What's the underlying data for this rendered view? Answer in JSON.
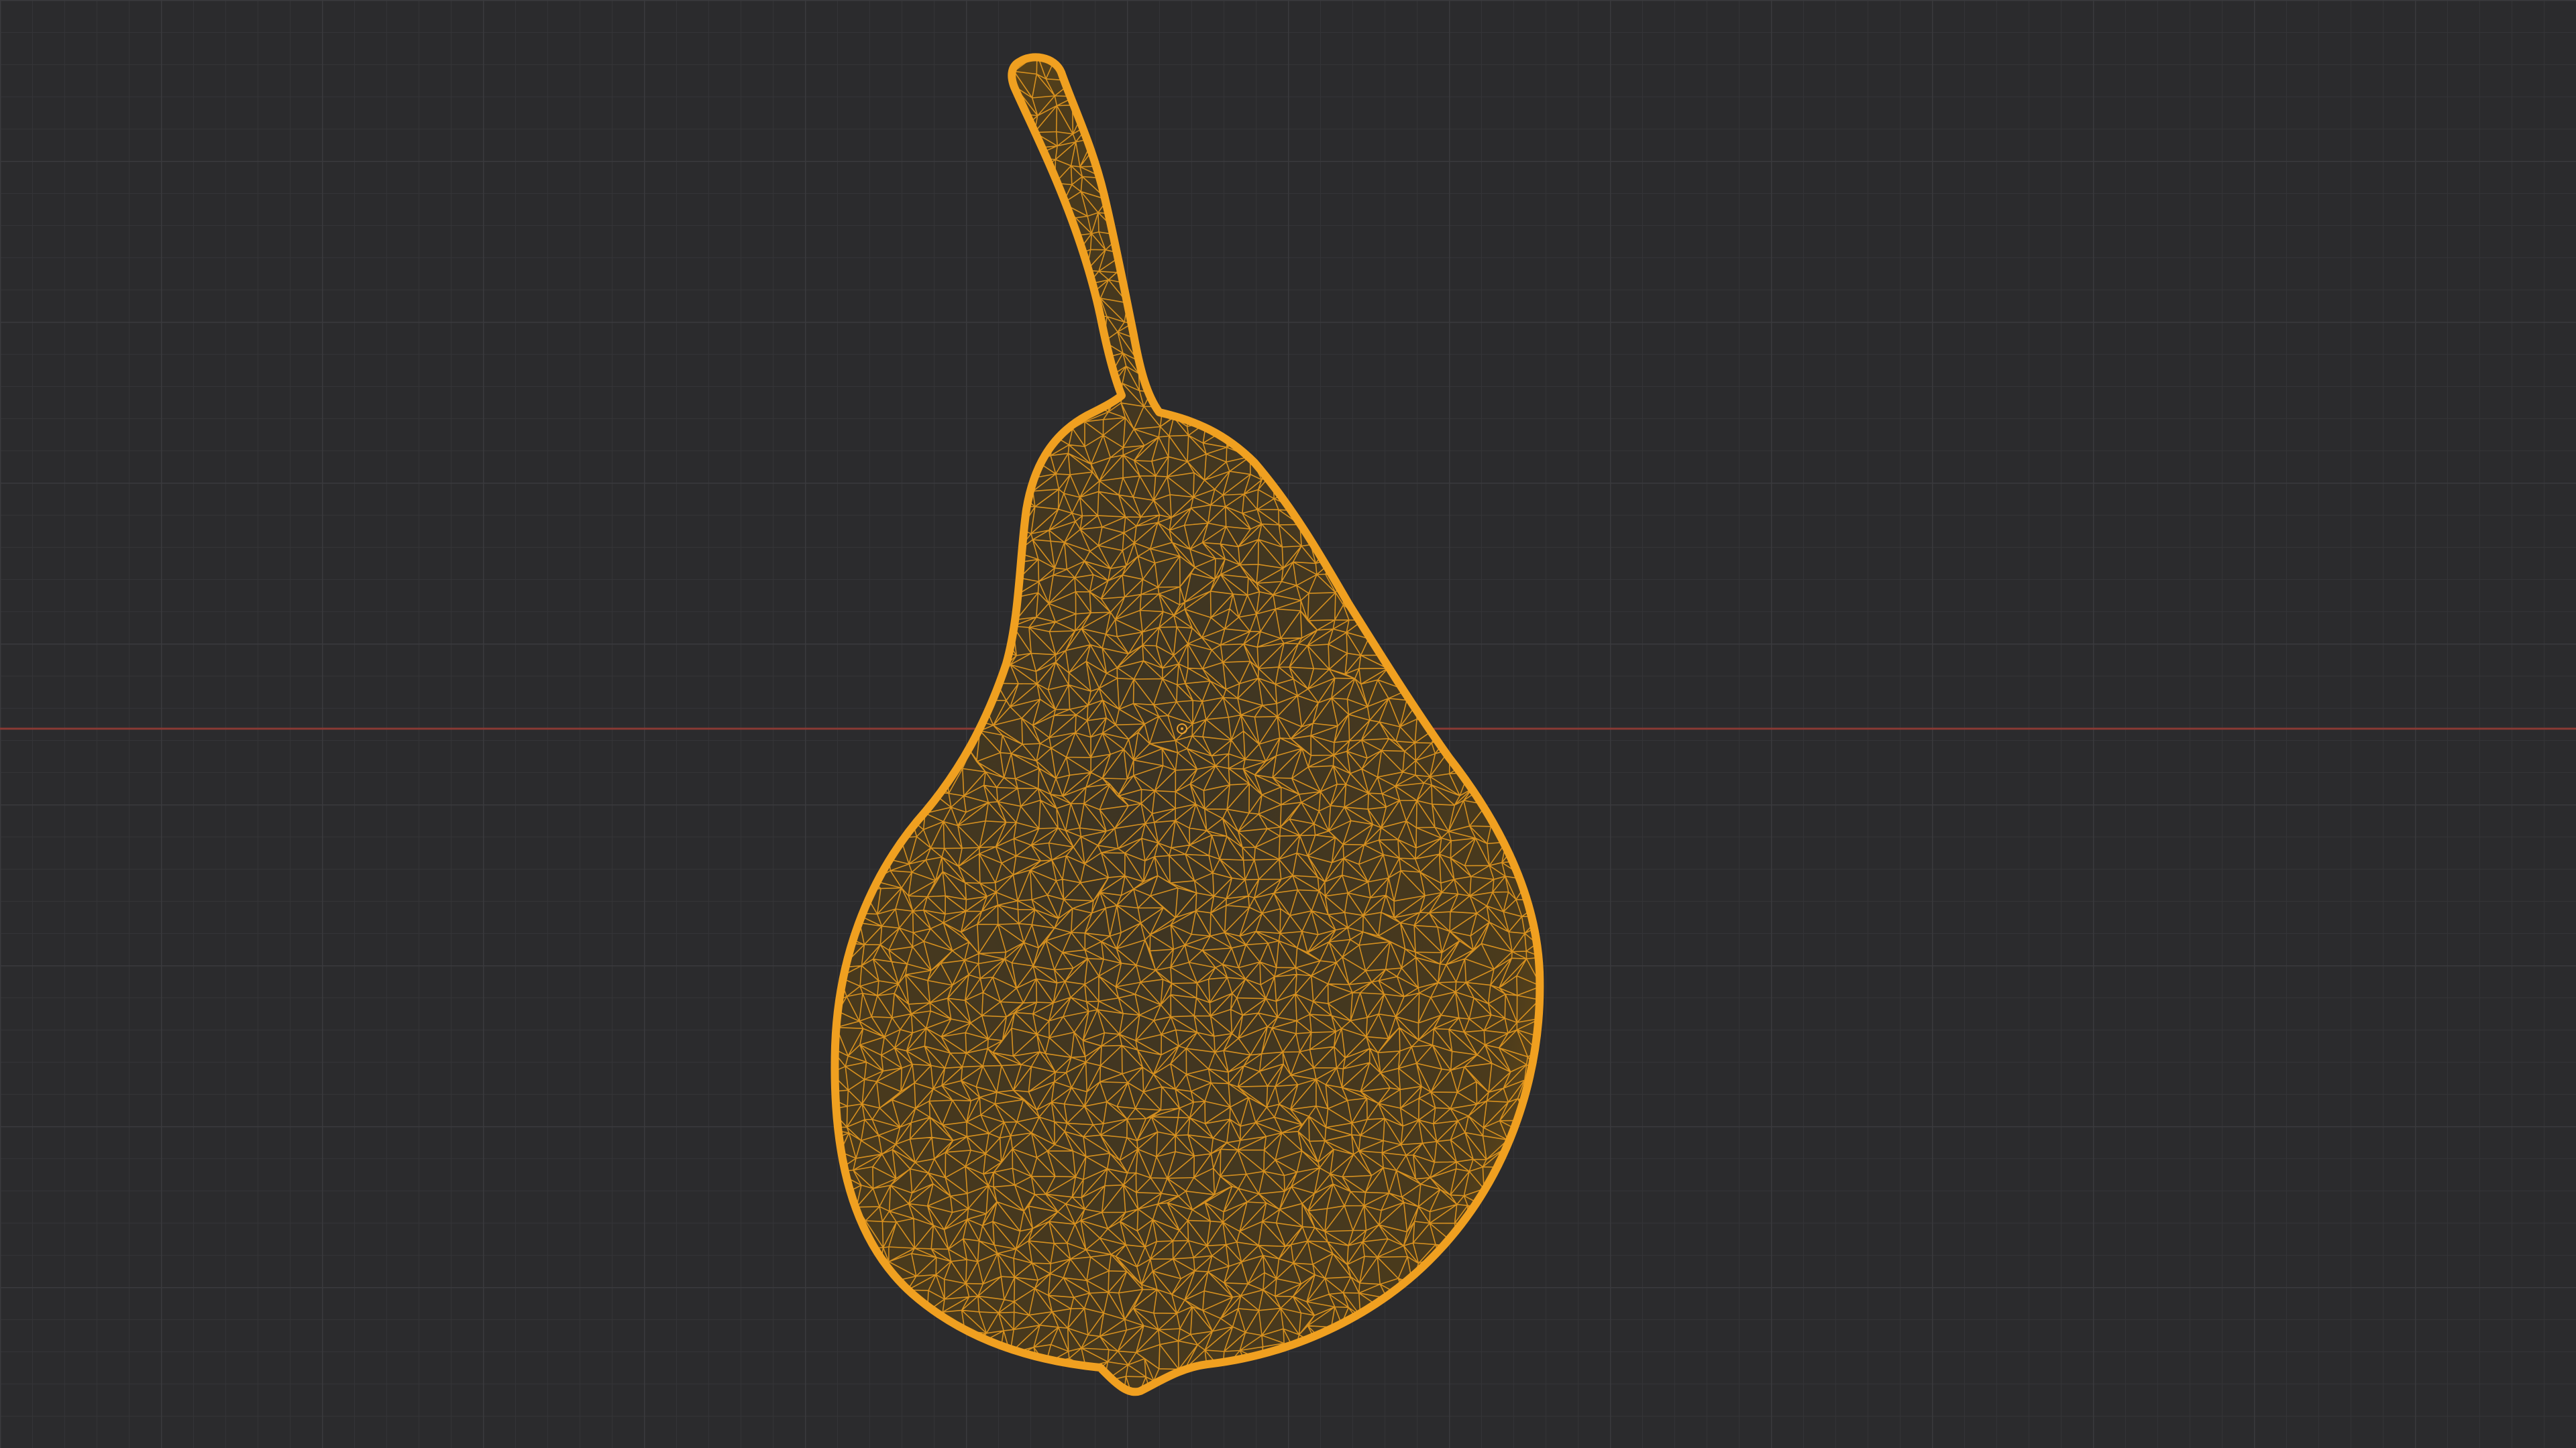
{
  "viewport": {
    "background_color": "#2b2b2d",
    "grid_minor_color": "#343437",
    "grid_major_color": "#3a3a3d",
    "x_axis_color": "#8a3a34",
    "mesh_color": "#f0a020",
    "mesh_fill_color": "#4a3a1e",
    "object_name": "pear",
    "display_mode": "wireframe"
  },
  "icons": {
    "origin": "origin-icon"
  }
}
